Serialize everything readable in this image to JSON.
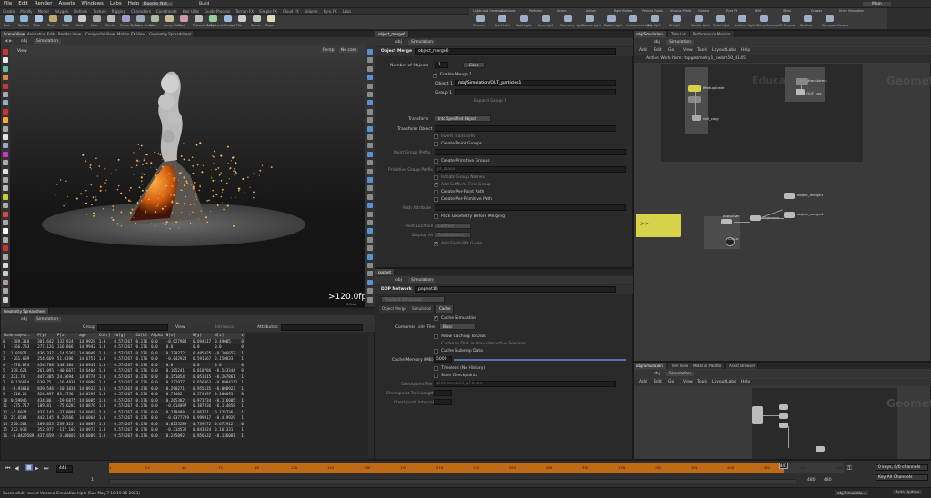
{
  "menu": [
    "File",
    "Edit",
    "Render",
    "Assets",
    "Windows",
    "Labs",
    "Help"
  ],
  "window": {
    "desktop": "Main",
    "title": "Doodle_Net...",
    "build": "Build"
  },
  "shelf_tabs": [
    "Create",
    "Modify",
    "Model",
    "Polygon",
    "Deform",
    "Texture",
    "Rigging",
    "Characters",
    "Constraints",
    "Hair Utils",
    "Guide Process",
    "Terrain FX",
    "Simple FX",
    "Cloud FX",
    "Volume",
    "Pyro FX",
    "Labs"
  ],
  "shelf_tools": [
    "Box",
    "Sphere",
    "Tube",
    "Torus",
    "Grid",
    "Null",
    "Line",
    "Circle",
    "Curve Bezier",
    "Draw Curve",
    "Path",
    "Spray Paint",
    "Font",
    "Platonic Solids",
    "L-System",
    "Metaball",
    "File",
    "Scene",
    "Dope"
  ],
  "shelf_tabs_right": [
    "Lights and Cameras",
    "Collisions",
    "Particles",
    "Grains",
    "Vellum",
    "Rigid Bodies",
    "Particle Fluids",
    "Viscous Fluids",
    "Oceans",
    "Pyro FX",
    "FEM",
    "Wires",
    "Crowds",
    "Drive Simulation"
  ],
  "shelf_tools_right": [
    "Camera",
    "Point Light",
    "Spot Light",
    "Area Light",
    "Geometry Light",
    "Volume Light",
    "Distant Light",
    "Environment Light",
    "Sky Light",
    "GI Light",
    "Caustic Light",
    "Portal Light",
    "Ambient Light",
    "Stereo Camera",
    "VR Camera",
    "Switcher",
    "Gamepad Camera"
  ],
  "viewer": {
    "tabs": [
      "Scene View",
      "Animation Editor",
      "Render View",
      "Composite View",
      "Motion FX View",
      "Geometry Spreadsheet"
    ],
    "path": [
      "obj",
      "Simulation"
    ],
    "label": "View",
    "persp": "Persp",
    "cam": "No cam",
    "fps": ">120.0fps",
    "stats": "3.3ms"
  },
  "spreadsheet": {
    "tab": "Geometry Spreadsheet",
    "path": [
      "obj",
      "Simulation"
    ],
    "group_label": "Group",
    "view_label": "View",
    "intrinsics_label": "Intrinsics",
    "attributes_label": "Attributes:",
    "node_label": "Node: object...",
    "columns": [
      "",
      "P[x]",
      "P[y]",
      "P[z]",
      "age",
      "Cd[r]",
      "Cd[g]",
      "Cd[b]",
      "Alpha",
      "N[x]",
      "N[y]",
      "N[z]",
      "v"
    ],
    "rows": [
      [
        "0",
        "-189.310",
        "381.642",
        "132.924",
        "14.9929",
        "1.0",
        "0.574267",
        "0.176",
        "0.0",
        "-0.627984",
        "0.694617",
        "0.49085",
        "0"
      ],
      [
        "1",
        "-366.783",
        "277.126",
        "116.866",
        "14.9942",
        "1.0",
        "0.574267",
        "0.176",
        "0.0",
        "0.0",
        "0.0",
        "0.0",
        "0"
      ],
      [
        "2",
        "1.01971",
        "436.337",
        "-14.5261",
        "14.9949",
        "1.0",
        "0.574267",
        "0.176",
        "0.0",
        "0.239272",
        "0.405325",
        "-0.106653",
        "1"
      ],
      [
        "3",
        "-261.689",
        "254.669",
        "51.0396",
        "14.6751",
        "1.0",
        "0.574267",
        "0.176",
        "0.0",
        "-0.042924",
        "0.591667",
        "0.150833",
        "1"
      ],
      [
        "4",
        "-376.074",
        "454.708",
        "148.104",
        "14.0941",
        "1.0",
        "0.574267",
        "0.176",
        "0.0",
        "0.0",
        "0.0",
        "0.0",
        "0"
      ],
      [
        "5",
        "338.621",
        "261.095",
        "-40.6673",
        "14.6404",
        "1.0",
        "0.574267",
        "0.176",
        "0.0",
        "0.105241",
        "0.818786",
        "-0.543344",
        "0"
      ],
      [
        "6",
        "221.74",
        "447.305",
        "24.5694",
        "14.0774",
        "1.0",
        "0.574267",
        "0.176",
        "0.0",
        "0.151054",
        "0.051415",
        "-0.267861",
        "1"
      ],
      [
        "7",
        "0.126674",
        "639.75",
        "-16.4938",
        "14.6089",
        "1.0",
        "0.574267",
        "0.176",
        "0.0",
        "0.272977",
        "0.656063",
        "-0.0904111",
        "1"
      ],
      [
        "8",
        "-0.93616",
        "839.546",
        "-10.1836",
        "14.0923",
        "1.0",
        "0.574267",
        "0.176",
        "0.0",
        "0.290271",
        "0.955135",
        "-0.088923",
        "1"
      ],
      [
        "9",
        "-210.24",
        "324.897",
        "83.2756",
        "14.0599",
        "1.0",
        "0.574267",
        "0.176",
        "0.0",
        "0.71402",
        "0.574397",
        "0.306695",
        "0"
      ],
      [
        "10",
        "0.59946",
        "434.86",
        "-19.6875",
        "14.6085",
        "1.0",
        "0.574267",
        "0.176",
        "0.0",
        "0.265382",
        "0.971734",
        "-0.116085",
        "1"
      ],
      [
        "11",
        "-275.717",
        "109.81",
        "-75.6283",
        "14.0876",
        "1.0",
        "0.574267",
        "0.176",
        "0.0",
        "-0.614097",
        "0.387836",
        "-0.114858",
        "1"
      ],
      [
        "12",
        "-1.6074",
        "437.142",
        "-37.9088",
        "14.6067",
        "1.0",
        "0.574267",
        "0.176",
        "0.0",
        "0.218488",
        "0.96771",
        "0.125736",
        "1"
      ],
      [
        "13",
        "21.6584",
        "442.145",
        "9.26566",
        "14.6064",
        "1.0",
        "0.574267",
        "0.176",
        "0.0",
        "-0.0377799",
        "0.999817",
        "-0.419929",
        "1"
      ],
      [
        "14",
        "270.561",
        "189.053",
        "239.325",
        "14.6087",
        "1.0",
        "0.574267",
        "0.176",
        "0.0",
        "0.0255289",
        "0.739272",
        "0.672912",
        "0"
      ],
      [
        "15",
        "222.938",
        "352.977",
        "-117.107",
        "14.0973",
        "1.0",
        "0.574267",
        "0.176",
        "0.0",
        "-0.314532",
        "0.843824",
        "0.161331",
        "1"
      ],
      [
        "16",
        "-0.0429589",
        "437.659",
        "-3.40601",
        "14.6089",
        "1.0",
        "0.574267",
        "0.176",
        "0.0",
        "0.245092",
        "0.956532",
        "-0.136081",
        "1"
      ]
    ]
  },
  "params": {
    "tab": "object_merge6",
    "path": [
      "obj",
      "Simulation"
    ],
    "node_type": "Object Merge",
    "node_name": "object_merge6",
    "num_objects_label": "Number of Objects",
    "num_objects": "1",
    "clear_label": "Clear",
    "enable_merge": "Enable Merge 1",
    "object1_label": "Object 1",
    "object1": "/obj/Simulation/OUT_particles1",
    "group1_label": "Group 1",
    "expand_group": "Expand Group 1",
    "transform_label": "Transform",
    "transform": "Into Specified Object",
    "transform_object_label": "Transform Object",
    "invert": "Invert Transform",
    "create_point_groups": "Create Point Groups",
    "point_group_prefix": "Point Group Prefix",
    "create_prim_groups": "Create Primitive Groups",
    "prim_group_prefix": "Primitive Group Prefix",
    "prim_prefix_value": "pt_/base",
    "ungroup": "Initiate Group Names",
    "add_suffix": "Add Suffix to First Group",
    "create_point_path": "Create Per-Point Path",
    "create_prim_path": "Create Per-Primitive Path",
    "path_attribute": "Path Attribute",
    "pack": "Pack Geometry Before Merging",
    "pivot_location": "Pivot Location",
    "pivot_value": "Centroid",
    "display_as": "Display As",
    "display_value": "Full Geometry",
    "add_fields": "Add Fields/Bit Guide"
  },
  "dop": {
    "tab": "popnet",
    "path": [
      "obj",
      "Simulation"
    ],
    "node_type": "DOP Network",
    "node_name": "popnet10",
    "playback": "Playback Simulation",
    "subtabs": [
      "Object Merge",
      "Simulation",
      "Cache"
    ],
    "cache_sim": "Cache Simulation",
    "compress_label": "Compress .sim Files",
    "compress_value": "Blosc",
    "allow_caching": "Allow Caching To Disk",
    "cache_noninteractive": "Cache to Disk in Non-Interactive Sessions",
    "cache_substep": "Cache Substep Data",
    "cache_memory_label": "Cache Memory (MB)",
    "cache_memory": "5000",
    "timeless": "Timeless (No History)",
    "save_checkpoints": "Save Checkpoints",
    "checkpoint_file": "Checkpoint File",
    "checkpoint_value": "$HIP/sim/$OS_$F4.sim",
    "checkpoint_trail": "Checkpoint Trail Length",
    "checkpoint_interval": "Checkpoint Interval"
  },
  "network_top": {
    "tabs": [
      "obj/Simulation",
      "Take List",
      "Performance Monitor"
    ],
    "path": [
      "obj",
      "Simulation"
    ],
    "menu": [
      "Add",
      "Edit",
      "Go",
      "View",
      "Tools",
      "Layout",
      "Labs",
      "Help"
    ],
    "breadcrumb": "Active Work Item: topgeometry1_nwbm50_8145",
    "context_left": "Education",
    "context_right": "Geometry",
    "nodes": [
      "fileduplicate",
      "transform1",
      "null_copy",
      "OUT_cav",
      "object_merge3",
      "object_merge4",
      "popsolver",
      "objmerge",
      "popnet",
      "output1",
      "OUT_particles1"
    ]
  },
  "network_bottom": {
    "tabs": [
      "obj/Simulation",
      "Tree View",
      "Material Palette",
      "Asset Browser"
    ],
    "path": [
      "obj",
      "Simulation"
    ],
    "menu": [
      "Add",
      "Edit",
      "Go",
      "View",
      "Tools",
      "Layout",
      "Labs",
      "Help"
    ],
    "context": "Geometry"
  },
  "timeline": {
    "frame": "441",
    "start": "1",
    "end": "480",
    "end2": "480",
    "ticks": [
      "1",
      "24",
      "48",
      "72",
      "96",
      "120",
      "144",
      "168",
      "192",
      "216",
      "240",
      "264",
      "288",
      "312",
      "336",
      "360",
      "384",
      "408",
      "432",
      "456",
      "480"
    ],
    "progress": 0.918,
    "keys_label": "0 keys, 0/0 channels",
    "key_all": "Key All Channels",
    "auto_update": "Auto Update"
  },
  "status": {
    "message": "Successfully saved Volcano Simulation.hiplc (Sun May 7 18:19:16 2023)",
    "file": "obj/Simulatio..."
  },
  "colors": {
    "accent": "#d47a1c",
    "node_yellow": "#d8d24a",
    "lava": "#e06a18",
    "select": "#e8b838"
  }
}
